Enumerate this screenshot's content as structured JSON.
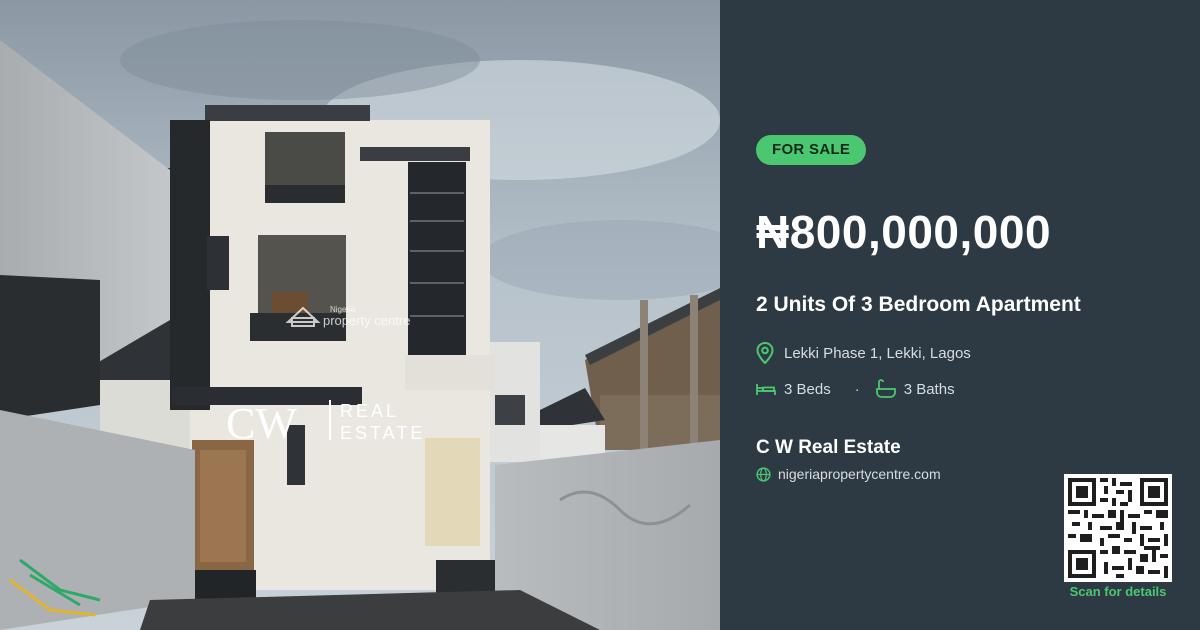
{
  "listing": {
    "status_badge": "FOR SALE",
    "price": "₦800,000,000",
    "title": "2 Units Of 3 Bedroom Apartment",
    "location": "Lekki Phase 1, Lekki, Lagos",
    "beds": "3 Beds",
    "separator": "·",
    "baths": "3 Baths",
    "agent": "C W Real Estate",
    "website": "nigeriapropertycentre.com",
    "qr_caption": "Scan for details"
  },
  "photo": {
    "watermark_small_top": "Nigeria",
    "watermark_small_bottom": "property centre",
    "agent_logo_mark": "CW",
    "agent_logo_line1": "REAL",
    "agent_logo_line2": "ESTATE"
  },
  "colors": {
    "panel_bg": "#2e3a43",
    "accent_green": "#4cc771",
    "text_white": "#ffffff",
    "text_muted": "#d7dde1"
  },
  "icons": {
    "location": "map-pin-icon",
    "beds": "bed-icon",
    "baths": "bathtub-icon",
    "website": "globe-icon",
    "qr": "qr-code"
  }
}
